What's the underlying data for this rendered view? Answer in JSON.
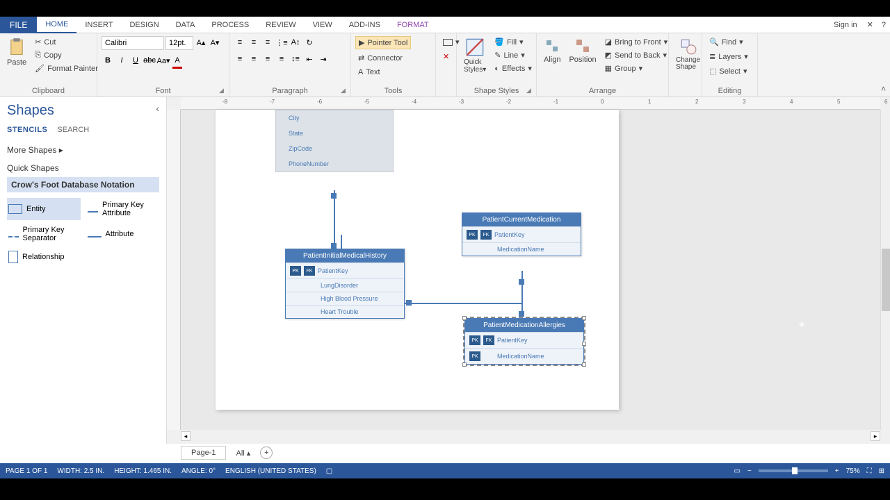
{
  "app": {
    "signin": "Sign in"
  },
  "tabs": {
    "file": "FILE",
    "home": "HOME",
    "insert": "INSERT",
    "design": "DESIGN",
    "data": "DATA",
    "process": "PROCESS",
    "review": "REVIEW",
    "view": "VIEW",
    "addins": "ADD-INS",
    "format": "FORMAT"
  },
  "ribbon": {
    "clipboard": {
      "paste": "Paste",
      "cut": "Cut",
      "copy": "Copy",
      "painter": "Format Painter",
      "label": "Clipboard"
    },
    "font": {
      "name": "Calibri",
      "size": "12pt.",
      "label": "Font"
    },
    "paragraph": {
      "label": "Paragraph"
    },
    "tools": {
      "pointer": "Pointer Tool",
      "connector": "Connector",
      "text": "Text",
      "label": "Tools"
    },
    "shapestyles": {
      "fill": "Fill",
      "line": "Line",
      "effects": "Effects",
      "label": "Shape Styles"
    },
    "arrange": {
      "align": "Align",
      "position": "Position",
      "front": "Bring to Front",
      "back": "Send to Back",
      "group": "Group",
      "label": "Arrange"
    },
    "change": {
      "change": "Change Shape",
      "label": ""
    },
    "editing": {
      "find": "Find",
      "layers": "Layers",
      "select": "Select",
      "label": "Editing"
    }
  },
  "shapes_panel": {
    "title": "Shapes",
    "tab_stencils": "STENCILS",
    "tab_search": "SEARCH",
    "more": "More Shapes",
    "quick": "Quick Shapes",
    "stencil": "Crow's Foot Database Notation",
    "items": {
      "entity": "Entity",
      "pka": "Primary Key Attribute",
      "pks": "Primary Key Separator",
      "attr": "Attribute",
      "rel": "Relationship"
    }
  },
  "ruler_ticks": [
    "-8",
    "-7",
    "-6",
    "-5",
    "-4",
    "-3",
    "-2",
    "-1",
    "0",
    "1",
    "2",
    "3",
    "4",
    "5",
    "6"
  ],
  "canvas": {
    "top_attrs": [
      "City",
      "State",
      "ZipCode",
      "PhoneNumber"
    ],
    "e1": {
      "title": "PatientInitialMedicalHistory",
      "pk": "PatientKey",
      "rows": [
        "LungDisorder",
        "High Blood Pressure",
        "Heart Trouble"
      ]
    },
    "e2": {
      "title": "PatientCurrentMedication",
      "pk": "PatientKey",
      "row": "MedicationName"
    },
    "e3": {
      "title": "PatientMedicationAllergies",
      "pk": "PatientKey",
      "row": "MedicationName"
    }
  },
  "pagetabs": {
    "page1": "Page-1",
    "all": "All"
  },
  "status": {
    "page": "PAGE 1 OF 1",
    "width": "WIDTH: 2.5 IN.",
    "height": "HEIGHT: 1.465 IN.",
    "angle": "ANGLE: 0°",
    "lang": "ENGLISH (UNITED STATES)",
    "zoom": "75%"
  }
}
